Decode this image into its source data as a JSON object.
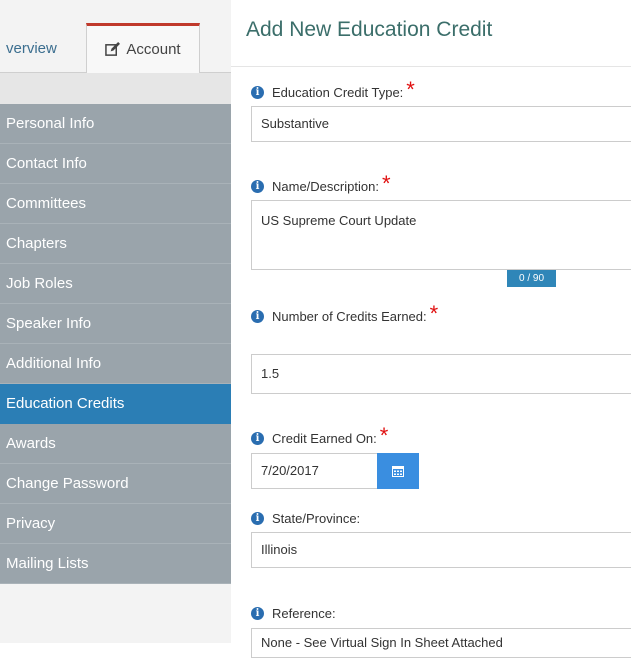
{
  "tabs": {
    "overview_label": "verview",
    "account_label": "Account"
  },
  "menu": {
    "items": [
      {
        "label": "Personal Info"
      },
      {
        "label": "Contact Info"
      },
      {
        "label": "Committees"
      },
      {
        "label": "Chapters"
      },
      {
        "label": "Job Roles"
      },
      {
        "label": "Speaker Info"
      },
      {
        "label": "Additional Info"
      },
      {
        "label": "Education Credits",
        "active": true
      },
      {
        "label": "Awards"
      },
      {
        "label": "Change Password"
      },
      {
        "label": "Privacy"
      },
      {
        "label": "Mailing Lists"
      }
    ]
  },
  "form": {
    "title": "Add New Education Credit",
    "credit_type_label": "Education Credit Type:",
    "credit_type_value": "Substantive",
    "name_label": "Name/Description:",
    "name_value": "US Supreme Court Update",
    "name_counter": "0 / 90",
    "credits_label": "Number of Credits Earned:",
    "credits_value": "1.5",
    "earned_on_label": "Credit Earned On:",
    "earned_on_value": "7/20/2017",
    "state_label": "State/Province:",
    "state_value": "Illinois",
    "reference_label": "Reference:",
    "reference_value": "None - See Virtual Sign In Sheet Attached"
  },
  "colors": {
    "accent_tab": "#c0392b",
    "menu_active": "#2b7eb5",
    "required": "#e01010",
    "calendar_button": "#3a8ee0"
  }
}
